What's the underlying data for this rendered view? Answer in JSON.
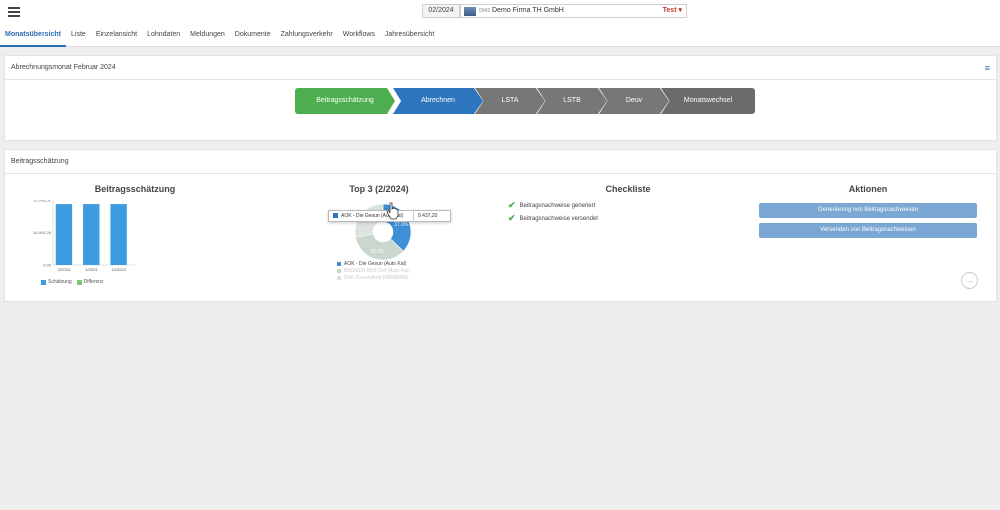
{
  "header": {
    "period": "02/2024",
    "company_number": "0042",
    "company_name": "Demo Firma TH GmbH",
    "environment": "Test",
    "environment_arrow": "▾"
  },
  "tabs": [
    {
      "label": "Monatsübersicht",
      "active": true
    },
    {
      "label": "Liste"
    },
    {
      "label": "Einzelansicht"
    },
    {
      "label": "Lohndaten"
    },
    {
      "label": "Meldungen"
    },
    {
      "label": "Dokumente"
    },
    {
      "label": "Zahlungsverkehr"
    },
    {
      "label": "Workflows"
    },
    {
      "label": "Jahresübersicht"
    }
  ],
  "month_panel": {
    "title": "Abrechnungsmonat Februar 2024",
    "menu_icon": "≡",
    "steps": [
      "Beitragsschätzung",
      "Abrechnen",
      "LSTA",
      "LSTB",
      "Deuv",
      "Monatswechsel"
    ]
  },
  "estimate_panel": {
    "title": "Beitragsschätzung",
    "bar_section_title": "Beitragsschätzung",
    "pie_section_title": "Top 3 (2/2024)",
    "checklist_title": "Checkliste",
    "actions_title": "Aktionen"
  },
  "chart_data": [
    {
      "type": "bar",
      "title": "Beitragsschätzung",
      "categories": [
        "2/2024",
        "1/2024",
        "12/2023"
      ],
      "series": [
        {
          "name": "Schätzung",
          "values": [
            30000,
            30000,
            30000
          ],
          "color": "#3d9be0"
        },
        {
          "name": "Differenz",
          "values": [
            0,
            0,
            0
          ],
          "color": "#7cc576"
        }
      ],
      "y_ticks": [
        "32.008,52",
        "16.004,26",
        "0,00"
      ],
      "ylim": [
        0,
        32008.52
      ]
    },
    {
      "type": "pie",
      "title": "Top 3 (2/2024)",
      "slices": [
        {
          "label": "AOK - Die Gesun (Auto Kal)",
          "value": 37,
          "color": "#3d8fd6",
          "label_text": "37.0%"
        },
        {
          "label": "BREMER BKK Gef (Auto Kal)",
          "value": 35,
          "color": "#c9d7cc",
          "label_text": "35.0%"
        },
        {
          "label": "DAK Gesundheit (48698880)",
          "value": 28,
          "color": "#dde4df",
          "label_text": ""
        }
      ],
      "tooltip": {
        "label": "AOK - Die Gesun (Auto Kal)",
        "value": "9.437,20"
      }
    }
  ],
  "checklist": [
    "Beitragsnachweise generiert",
    "Beitragsnachweise versendet"
  ],
  "actions": [
    "Generierung von Beitragsnachweisen",
    "Versenden von Beitragsnachweisen"
  ],
  "next_icon": "→"
}
